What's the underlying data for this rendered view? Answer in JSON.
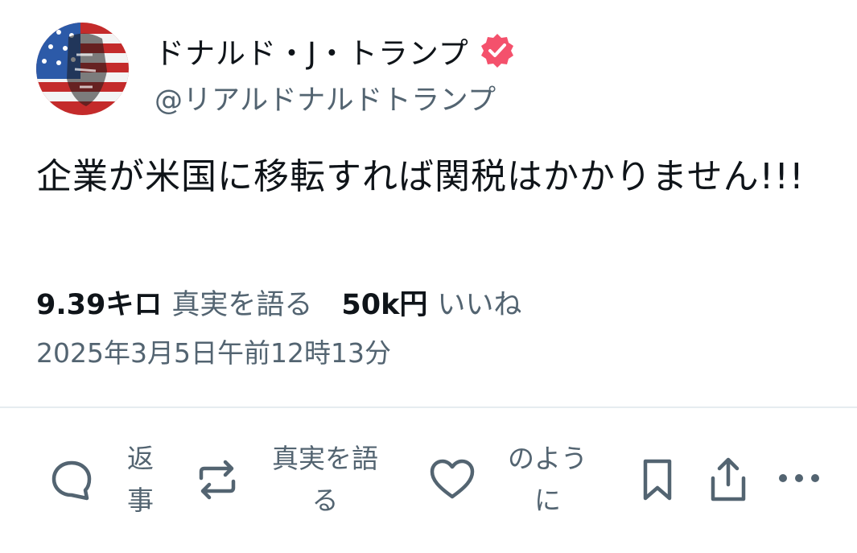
{
  "post": {
    "author_name": "ドナルド・J・トランプ",
    "handle": "@リアルドナルドトランプ",
    "text": "企業が米国に移転すれば関税はかかりません!!!",
    "stats": {
      "retruths_count": "9.39キロ",
      "retruths_label": "真実を語る",
      "likes_count": "50k円",
      "likes_label": "いいね"
    },
    "timestamp": "2025年3月5日午前12時13分"
  },
  "actions": {
    "reply_label_line1": "返",
    "reply_label_line2": "事",
    "retruth_label_line1": "真実を語",
    "retruth_label_line2": "る",
    "like_label_line1": "のよう",
    "like_label_line2": "に"
  },
  "colors": {
    "verified_badge": "#f4516c",
    "secondary_text": "#536471",
    "primary_text": "#0f1419",
    "divider": "#e6ecf0"
  },
  "icons": [
    "reply-icon",
    "retruth-icon",
    "like-icon",
    "bookmark-icon",
    "share-icon",
    "more-icon",
    "verified-badge-icon"
  ]
}
